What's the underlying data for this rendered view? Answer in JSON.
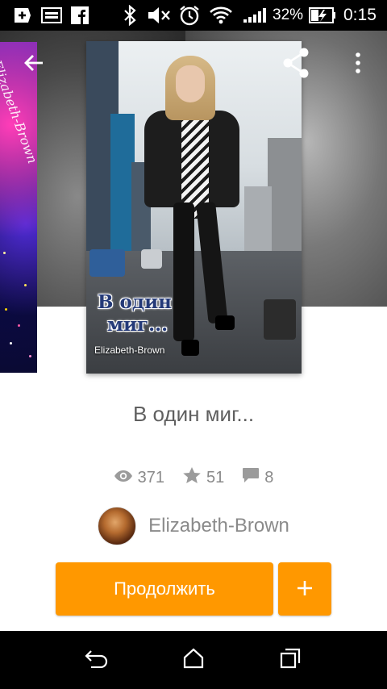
{
  "status_bar": {
    "icons": [
      "plus-box-icon",
      "image-icon",
      "facebook-icon",
      "bluetooth-icon",
      "mute-icon",
      "alarm-icon",
      "wifi-icon",
      "signal-icon",
      "battery-charging-icon"
    ],
    "battery_percent": "32%",
    "time": "0:15"
  },
  "hero": {
    "back_icon": "arrow-left-icon",
    "share_icon": "share-icon",
    "more_icon": "more-vertical-icon",
    "neighbor_cover_text": "Elizabeth-Brown",
    "cover": {
      "title_line1": "В один",
      "title_line2": "миг...",
      "author": "Elizabeth-Brown"
    }
  },
  "story": {
    "title": "В один миг...",
    "stats": {
      "views": "371",
      "votes": "51",
      "comments": "8",
      "views_icon": "eye-icon",
      "votes_icon": "star-icon",
      "comments_icon": "comment-icon"
    },
    "author": {
      "name": "Elizabeth-Brown",
      "avatar_icon": "avatar"
    }
  },
  "actions": {
    "continue_label": "Продолжить",
    "add_icon": "plus-icon",
    "accent_color": "#ff9800"
  },
  "nav_bar": {
    "back_icon": "nav-back-icon",
    "home_icon": "nav-home-icon",
    "recents_icon": "nav-recents-icon"
  }
}
